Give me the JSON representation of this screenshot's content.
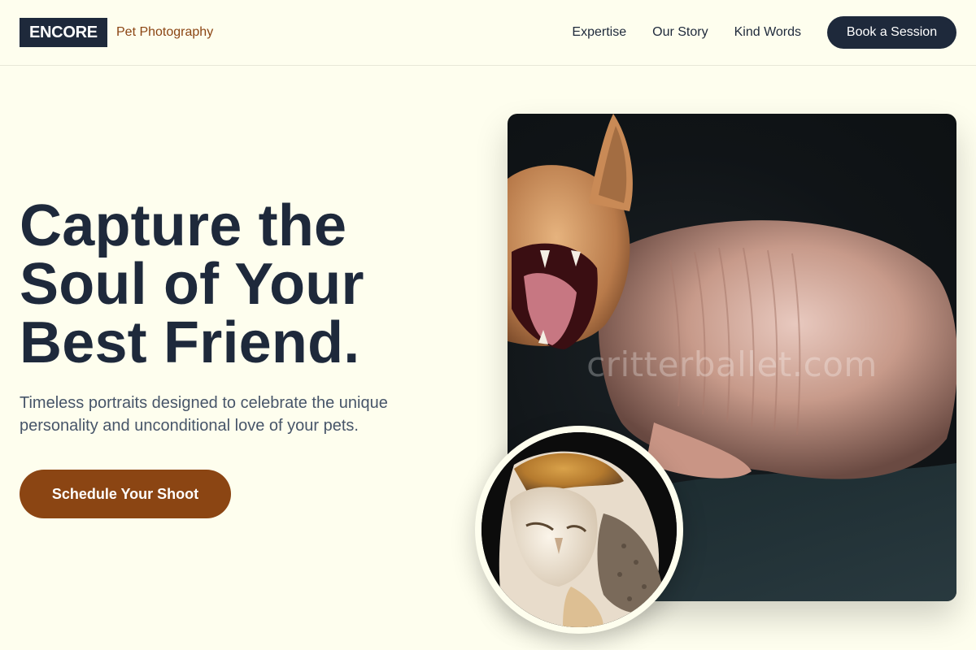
{
  "brand": {
    "logo": "ENCORE",
    "tagline": "Pet Photography"
  },
  "nav": {
    "items": [
      "Expertise",
      "Our Story",
      "Kind Words"
    ],
    "cta": "Book a Session"
  },
  "hero": {
    "title_lines": [
      "Capture the",
      "Soul of Your",
      "Best Friend."
    ],
    "subtitle": "Timeless portraits designed to celebrate the unique personality and unconditional love of your pets.",
    "cta": "Schedule Your Shoot"
  },
  "images": {
    "main": {
      "subject": "hairless sphynx cat yawning",
      "watermark": "critterballet.com"
    },
    "inset": {
      "subject": "barn owl"
    }
  },
  "colors": {
    "background": "#fefeee",
    "navy": "#1e293b",
    "brown": "#8b4513",
    "subtitle": "#475569"
  }
}
